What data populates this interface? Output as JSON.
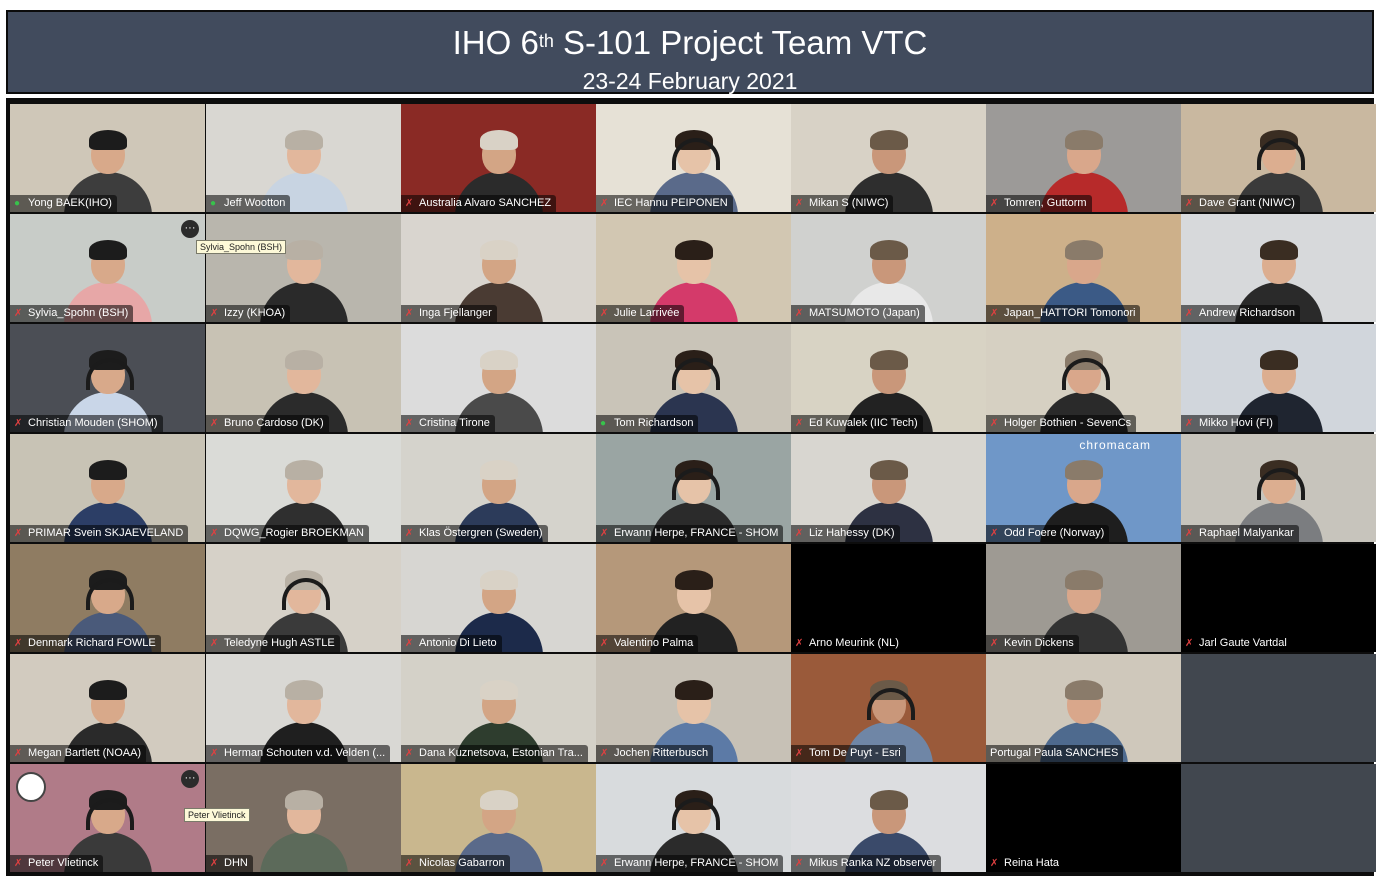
{
  "banner": {
    "title_pre": "IHO 6",
    "title_sup": "th",
    "title_post": " S-101 Project Team VTC",
    "date": "23-24 February 2021"
  },
  "participants": [
    {
      "name": "Yong BAEK(IHO)",
      "mic": "speaking"
    },
    {
      "name": "Jeff Wootton",
      "mic": "speaking"
    },
    {
      "name": "Australia Alvaro SANCHEZ",
      "mic": "muted"
    },
    {
      "name": "IEC Hannu PEIPONEN",
      "mic": "muted"
    },
    {
      "name": "Mikan S (NIWC)",
      "mic": "muted"
    },
    {
      "name": "Tomren, Guttorm",
      "mic": "muted"
    },
    {
      "name": "Dave Grant (NIWC)",
      "mic": "muted"
    },
    {
      "name": "Sylvia_Spohn (BSH)",
      "mic": "muted"
    },
    {
      "name": "Izzy (KHOA)",
      "mic": "muted"
    },
    {
      "name": "Inga Fjellanger",
      "mic": "muted"
    },
    {
      "name": "Julie Larrivée",
      "mic": "muted"
    },
    {
      "name": "MATSUMOTO (Japan)",
      "mic": "muted"
    },
    {
      "name": "Japan_HATTORI Tomonori",
      "mic": "muted"
    },
    {
      "name": "Andrew Richardson",
      "mic": "muted"
    },
    {
      "name": "Christian Mouden (SHOM)",
      "mic": "muted"
    },
    {
      "name": "Bruno Cardoso (DK)",
      "mic": "muted"
    },
    {
      "name": "Cristina Tirone",
      "mic": "muted"
    },
    {
      "name": "Tom Richardson",
      "mic": "speaking"
    },
    {
      "name": "Ed Kuwalek (IIC Tech)",
      "mic": "muted"
    },
    {
      "name": "Holger Bothien - SevenCs",
      "mic": "muted"
    },
    {
      "name": "Mikko Hovi (FI)",
      "mic": "muted"
    },
    {
      "name": "PRIMAR Svein SKJAEVELAND",
      "mic": "muted"
    },
    {
      "name": "DQWG_Rogier BROEKMAN",
      "mic": "muted"
    },
    {
      "name": "Klas Östergren (Sweden)",
      "mic": "muted"
    },
    {
      "name": "Erwann Herpe, FRANCE - SHOM",
      "mic": "muted"
    },
    {
      "name": "Liz Hahessy (DK)",
      "mic": "muted"
    },
    {
      "name": "Odd Foere (Norway)",
      "mic": "muted"
    },
    {
      "name": "Raphael Malyankar",
      "mic": "muted"
    },
    {
      "name": "Denmark Richard FOWLE",
      "mic": "muted"
    },
    {
      "name": "Teledyne Hugh ASTLE",
      "mic": "muted"
    },
    {
      "name": "Antonio Di Lieto",
      "mic": "muted"
    },
    {
      "name": "Valentino Palma",
      "mic": "muted"
    },
    {
      "name": "Arno Meurink (NL)",
      "mic": "muted"
    },
    {
      "name": "Kevin Dickens",
      "mic": "muted"
    },
    {
      "name": "Jarl Gaute Vartdal",
      "mic": "muted"
    },
    {
      "name": "Megan Bartlett (NOAA)",
      "mic": "muted"
    },
    {
      "name": "Herman Schouten v.d. Velden  (...",
      "mic": "muted"
    },
    {
      "name": "Dana Kuznetsova, Estonian Tra...",
      "mic": "muted"
    },
    {
      "name": "Jochen Ritterbusch",
      "mic": "muted"
    },
    {
      "name": "Tom De Puyt - Esri",
      "mic": "muted"
    },
    {
      "name": "Portugal Paula SANCHES",
      "mic": "none"
    },
    {
      "name": "",
      "mic": "none"
    },
    {
      "name": "Peter Vlietinck",
      "mic": "muted"
    },
    {
      "name": "DHN",
      "mic": "muted"
    },
    {
      "name": "Nicolas Gabarron",
      "mic": "muted"
    },
    {
      "name": "Erwann Herpe, FRANCE - SHOM",
      "mic": "muted"
    },
    {
      "name": "Mikus Ranka NZ observer",
      "mic": "muted"
    },
    {
      "name": "Reina Hata",
      "mic": "muted"
    },
    {
      "name": "",
      "mic": "none"
    }
  ],
  "tooltips": {
    "sylvia": "Sylvia_Spohn (BSH)",
    "peter": "Peter Vlietinck"
  },
  "more_button": "···",
  "chromacam": "chromacam",
  "icons": {
    "mic_speaking": "mic-icon",
    "mic_muted": "mic-muted-icon"
  },
  "colors": {
    "banner_bg": "#414b5d",
    "mic_on": "#38c24c",
    "mic_off": "#e04040",
    "tile_empty": "#000000"
  }
}
